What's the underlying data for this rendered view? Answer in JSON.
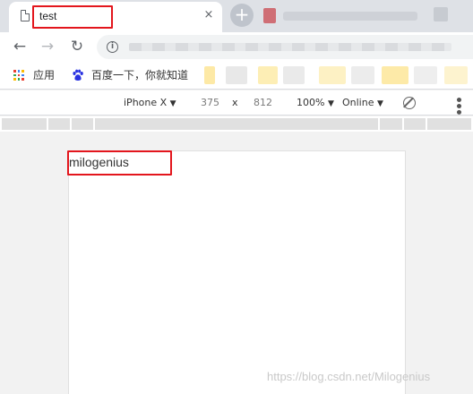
{
  "tabs": [
    {
      "title": "test",
      "active": true
    },
    {
      "title": "",
      "active": false
    }
  ],
  "icons": {
    "tab_favicon": "document-icon",
    "close": "close-icon",
    "new_tab": "plus-icon",
    "back": "back-arrow-icon",
    "forward": "forward-arrow-icon",
    "reload": "reload-icon",
    "site_info": "info-icon",
    "apps": "apps-grid-icon",
    "baidu": "baidu-paw-icon",
    "rotate": "rotate-icon",
    "more": "more-options-icon"
  },
  "glyphs": {
    "close": "×",
    "new_tab": "+",
    "back": "←",
    "forward": "→",
    "reload": "↻",
    "info": "i",
    "kebab": "•••"
  },
  "bookmarks": {
    "apps_label": "应用",
    "baidu_label": "百度一下，你就知道"
  },
  "device_toolbar": {
    "device": "iPhone X",
    "width": "375",
    "separator": "x",
    "height": "812",
    "zoom": "100%",
    "network": "Online",
    "dropdown_caret": "▼"
  },
  "page": {
    "body_text": "milogenius"
  },
  "watermark": "https://blog.csdn.net/Milogenius",
  "colors": {
    "highlight": "#e3161d",
    "tabstrip": "#dee1e6",
    "baidu_blue": "#2932e1"
  }
}
